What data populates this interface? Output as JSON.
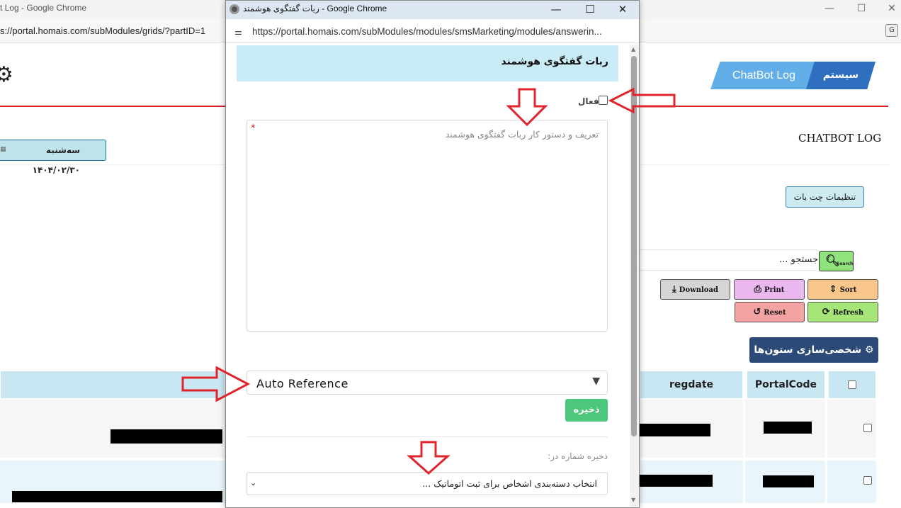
{
  "background_window": {
    "title": "t Log - Google Chrome",
    "url": "s://portal.homais.com/subModules/grids/?partID=1",
    "tab_system": "سیستم",
    "tab_chatbot": "ChatBot Log",
    "date": "سه‌شنبه ۱۴۰۴/۰۲/۳۰",
    "page_heading": "CHATBOT LOG",
    "settings_button": "تنظیمات چت بات",
    "search_value": "جستجو ...",
    "search_button": "Search",
    "toolbar": {
      "download": "Download",
      "print": "Print",
      "sort": "Sort",
      "reset": "Reset",
      "refresh": "Refresh"
    },
    "columns_button": "⚙ شخصی‌سازی ستون‌ها",
    "table_headers": [
      "PortalCode",
      "regdate"
    ],
    "translate_icon": "G"
  },
  "popup": {
    "title": "ربات گفتگوی هوشمند - Google Chrome",
    "url": "https://portal.homais.com/subModules/modules/smsMarketing/modules/answerin...",
    "header": "ربات گفتگوی هوشمند",
    "active_label": "فعال",
    "textarea_placeholder": "تعریف و دستور کار ربات گفتگوی هوشمند",
    "required_mark": "*",
    "auto_reference": "Auto Reference",
    "save_button": "ذخیره",
    "save_number_label": "ذخیره شماره در:",
    "category_select": "انتخاب دسته‌بندی اشخاص برای ثبت اتوماتیک ..."
  },
  "colors": {
    "arrow_red": "#e0242c",
    "header_band": "#c8ebf5",
    "save_green": "#4ec77e"
  }
}
